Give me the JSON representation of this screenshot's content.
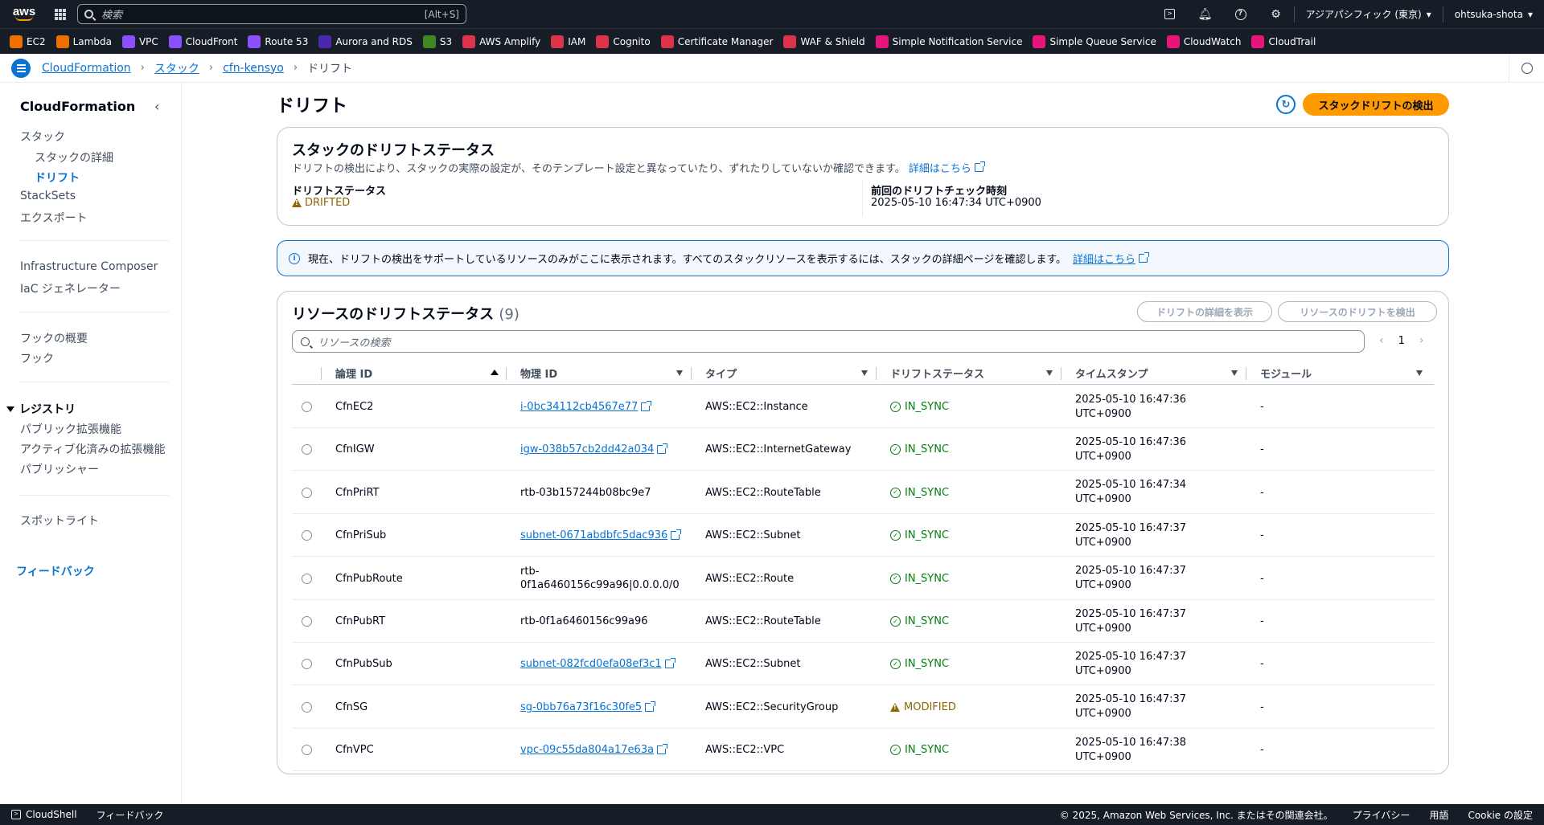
{
  "topnav": {
    "logo": "aws",
    "search_placeholder": "検索",
    "search_shortcut": "[Alt+S]",
    "region": "アジアパシフィック (東京)",
    "user": "ohtsuka-shota"
  },
  "services": [
    {
      "label": "EC2",
      "color": "#ed7100"
    },
    {
      "label": "Lambda",
      "color": "#ed7100"
    },
    {
      "label": "VPC",
      "color": "#8c4fff"
    },
    {
      "label": "CloudFront",
      "color": "#8c4fff"
    },
    {
      "label": "Route 53",
      "color": "#8c4fff"
    },
    {
      "label": "Aurora and RDS",
      "color": "#4d27aa"
    },
    {
      "label": "S3",
      "color": "#3f8624"
    },
    {
      "label": "AWS Amplify",
      "color": "#dd344c"
    },
    {
      "label": "IAM",
      "color": "#dd344c"
    },
    {
      "label": "Cognito",
      "color": "#dd344c"
    },
    {
      "label": "Certificate Manager",
      "color": "#dd344c"
    },
    {
      "label": "WAF & Shield",
      "color": "#dd344c"
    },
    {
      "label": "Simple Notification Service",
      "color": "#e7157b"
    },
    {
      "label": "Simple Queue Service",
      "color": "#e7157b"
    },
    {
      "label": "CloudWatch",
      "color": "#e7157b"
    },
    {
      "label": "CloudTrail",
      "color": "#e7157b"
    }
  ],
  "breadcrumb": {
    "items": [
      "CloudFormation",
      "スタック",
      "cfn-kensyo"
    ],
    "current": "ドリフト"
  },
  "sidebar": {
    "title": "CloudFormation",
    "stacks": "スタック",
    "stack_details": "スタックの詳細",
    "drift": "ドリフト",
    "stacksets": "StackSets",
    "exports": "エクスポート",
    "infra_composer": "Infrastructure Composer",
    "iac_generator": "IaC ジェネレーター",
    "hooks_overview": "フックの概要",
    "hooks": "フック",
    "registry": "レジストリ",
    "public_ext": "パブリック拡張機能",
    "activated_ext": "アクティブ化済みの拡張機能",
    "publisher": "パブリッシャー",
    "spotlight": "スポットライト",
    "feedback": "フィードバック"
  },
  "main": {
    "title": "ドリフト",
    "detect_stack_drift": "スタックドリフトの検出",
    "status_card": {
      "title": "スタックのドリフトステータス",
      "description": "ドリフトの検出により、スタックの実際の設定が、そのテンプレート設定と異なっていたり、ずれたりしていないか確認できます。",
      "learn_more": "詳細はこちら",
      "drift_status_label": "ドリフトステータス",
      "drift_status_value": "DRIFTED",
      "last_check_label": "前回のドリフトチェック時刻",
      "last_check_value": "2025-05-10 16:47:34 UTC+0900"
    },
    "info": {
      "text": "現在、ドリフトの検出をサポートしているリソースのみがここに表示されます。すべてのスタックリソースを表示するには、スタックの詳細ページを確認します。",
      "learn_more": "詳細はこちら"
    },
    "resources": {
      "title": "リソースのドリフトステータス",
      "count": "(9)",
      "view_details": "ドリフトの詳細を表示",
      "detect_resource": "リソースのドリフトを検出",
      "search_placeholder": "リソースの検索",
      "page": "1",
      "columns": {
        "logical_id": "論理 ID",
        "physical_id": "物理 ID",
        "type": "タイプ",
        "drift_status": "ドリフトステータス",
        "timestamp": "タイムスタンプ",
        "module": "モジュール"
      },
      "rows": [
        {
          "logical": "CfnEC2",
          "physical": "i-0bc34112cb4567e77",
          "physical_line2": "",
          "link": true,
          "type": "AWS::EC2::Instance",
          "status": "IN_SYNC",
          "ts1": "2025-05-10 16:47:36",
          "ts2": "UTC+0900",
          "module": "-"
        },
        {
          "logical": "CfnIGW",
          "physical": "igw-038b57cb2dd42a034",
          "physical_line2": "",
          "link": true,
          "type": "AWS::EC2::InternetGateway",
          "status": "IN_SYNC",
          "ts1": "2025-05-10 16:47:36",
          "ts2": "UTC+0900",
          "module": "-"
        },
        {
          "logical": "CfnPriRT",
          "physical": "rtb-03b157244b08bc9e7",
          "physical_line2": "",
          "link": false,
          "type": "AWS::EC2::RouteTable",
          "status": "IN_SYNC",
          "ts1": "2025-05-10 16:47:34",
          "ts2": "UTC+0900",
          "module": "-"
        },
        {
          "logical": "CfnPriSub",
          "physical": "subnet-0671abdbfc5dac936",
          "physical_line2": "",
          "link": true,
          "type": "AWS::EC2::Subnet",
          "status": "IN_SYNC",
          "ts1": "2025-05-10 16:47:37",
          "ts2": "UTC+0900",
          "module": "-"
        },
        {
          "logical": "CfnPubRoute",
          "physical": "rtb-",
          "physical_line2": "0f1a6460156c99a96|0.0.0.0/0",
          "link": false,
          "type": "AWS::EC2::Route",
          "status": "IN_SYNC",
          "ts1": "2025-05-10 16:47:37",
          "ts2": "UTC+0900",
          "module": "-"
        },
        {
          "logical": "CfnPubRT",
          "physical": "rtb-0f1a6460156c99a96",
          "physical_line2": "",
          "link": false,
          "type": "AWS::EC2::RouteTable",
          "status": "IN_SYNC",
          "ts1": "2025-05-10 16:47:37",
          "ts2": "UTC+0900",
          "module": "-"
        },
        {
          "logical": "CfnPubSub",
          "physical": "subnet-082fcd0efa08ef3c1",
          "physical_line2": "",
          "link": true,
          "type": "AWS::EC2::Subnet",
          "status": "IN_SYNC",
          "ts1": "2025-05-10 16:47:37",
          "ts2": "UTC+0900",
          "module": "-"
        },
        {
          "logical": "CfnSG",
          "physical": "sg-0bb76a73f16c30fe5",
          "physical_line2": "",
          "link": true,
          "type": "AWS::EC2::SecurityGroup",
          "status": "MODIFIED",
          "ts1": "2025-05-10 16:47:37",
          "ts2": "UTC+0900",
          "module": "-"
        },
        {
          "logical": "CfnVPC",
          "physical": "vpc-09c55da804a17e63a",
          "physical_line2": "",
          "link": true,
          "type": "AWS::EC2::VPC",
          "status": "IN_SYNC",
          "ts1": "2025-05-10 16:47:38",
          "ts2": "UTC+0900",
          "module": "-"
        }
      ]
    }
  },
  "footer": {
    "cloudshell": "CloudShell",
    "feedback": "フィードバック",
    "copyright": "© 2025, Amazon Web Services, Inc. またはその関連会社。",
    "privacy": "プライバシー",
    "terms": "用語",
    "cookie": "Cookie の設定"
  }
}
